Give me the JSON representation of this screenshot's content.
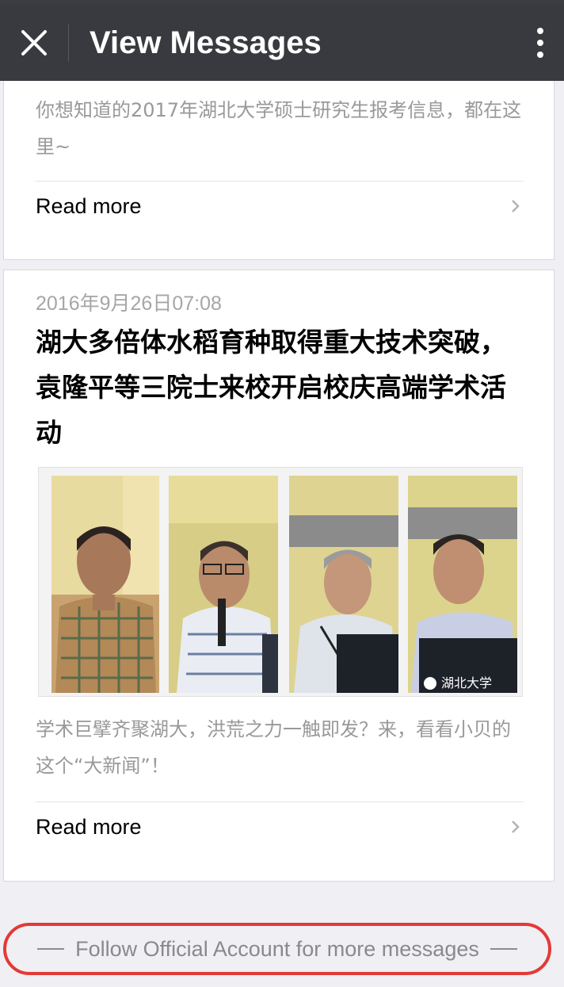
{
  "header": {
    "title": "View Messages",
    "close_icon": "close-icon",
    "menu_icon": "more-vertical-icon"
  },
  "articles": [
    {
      "digest": "你想知道的2017年湖北大学硕士研究生报考信息，都在这里~",
      "read_more": "Read more"
    },
    {
      "date": "2016年9月26日07:08",
      "title": "湖大多倍体水稻育种取得重大技术突破，袁隆平等三院士来校开启校庆高端学术活动",
      "image_watermark": "湖北大学",
      "digest": "学术巨擘齐聚湖大，洪荒之力一触即发？来，看看小贝的这个“大新闻”！",
      "read_more": "Read more"
    }
  ],
  "footer": {
    "follow_text": "Follow Official Account for more messages"
  },
  "colors": {
    "titlebar": "#393a3f",
    "highlight_ring": "#e23a36"
  }
}
